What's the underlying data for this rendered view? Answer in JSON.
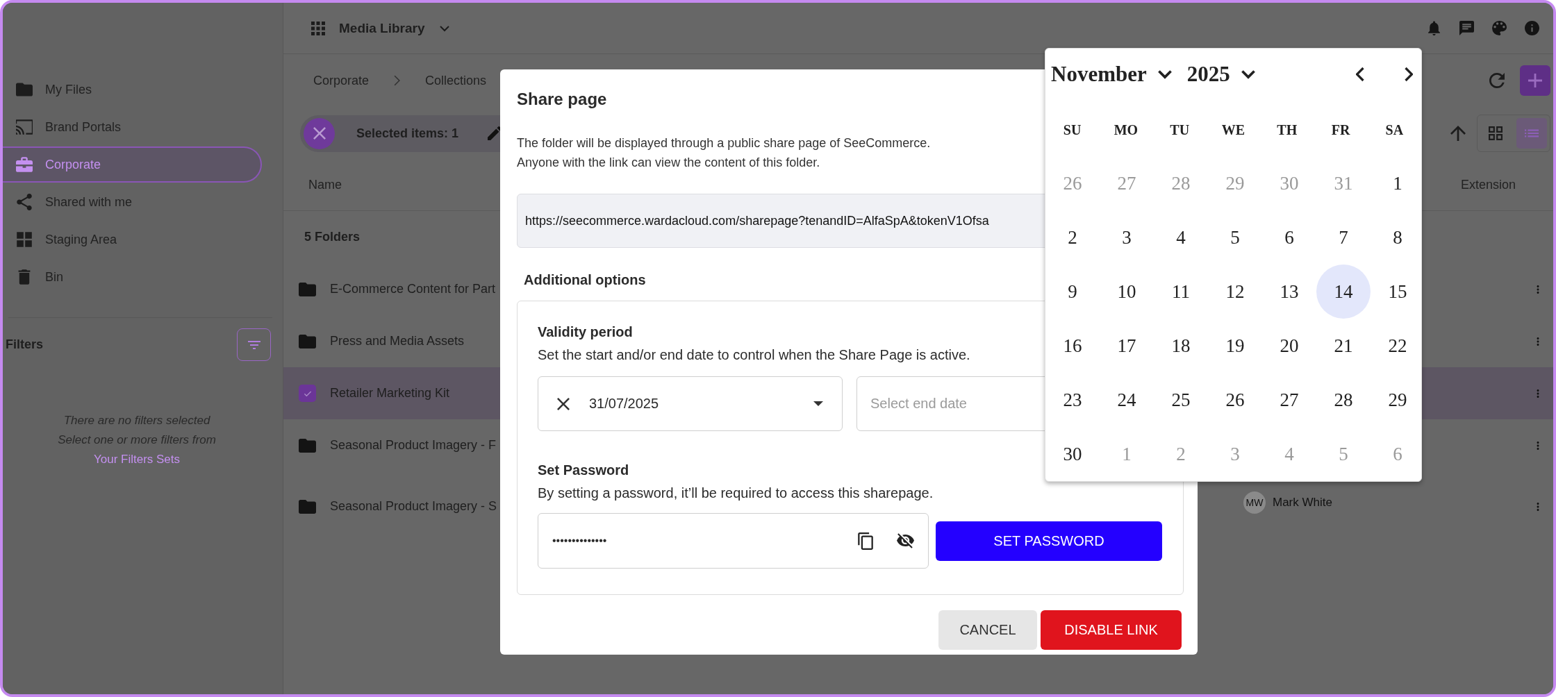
{
  "app": {
    "title": "Media Library"
  },
  "sidebar": {
    "items": [
      {
        "label": "My Files",
        "kind": "folder",
        "selected": false
      },
      {
        "label": "Brand Portals",
        "kind": "cast",
        "selected": false
      },
      {
        "label": "Corporate",
        "kind": "briefcase",
        "selected": true
      },
      {
        "label": "Shared with me",
        "kind": "share",
        "selected": false
      },
      {
        "label": "Staging Area",
        "kind": "grid",
        "selected": false
      },
      {
        "label": "Bin",
        "kind": "trash",
        "selected": false
      }
    ],
    "filters": {
      "title": "Filters",
      "empty_lines": [
        "There are no filters selected",
        "Select one or more filters from"
      ],
      "link": "Your Filters Sets"
    }
  },
  "breadcrumb": [
    "Corporate",
    "Collections"
  ],
  "selection": {
    "label": "Selected items: 1"
  },
  "view_toggle": [
    {
      "kind": "grid",
      "selected": false
    },
    {
      "kind": "list",
      "selected": true
    }
  ],
  "table": {
    "columns": [
      "Name",
      "Extension"
    ],
    "group_label": "5 Folders",
    "rows": [
      {
        "name": "E-Commerce Content for Part",
        "selected": false
      },
      {
        "name": "Press and Media Assets",
        "selected": false
      },
      {
        "name": "Retailer Marketing Kit",
        "selected": true
      },
      {
        "name": "Seasonal Product Imagery - F",
        "selected": false
      },
      {
        "name": "Seasonal Product Imagery - S",
        "selected": false,
        "owner": {
          "initials": "MW",
          "name": "Mark White"
        }
      }
    ]
  },
  "dialog": {
    "title": "Share page",
    "description": [
      "The folder will be displayed through a public share page of SeeCommerce.",
      "Anyone with the link can view the content of this folder."
    ],
    "url": "https://seecommerce.wardacloud.com/sharepage?tenandID=AlfaSpA&tokenV1Ofsa",
    "options_title": "Additional options",
    "validity": {
      "title": "Validity period",
      "hint": "Set the start and/or end date to control when the Share Page is active.",
      "start_date": "31/07/2025",
      "end_placeholder": "Select end date"
    },
    "password": {
      "title": "Set Password",
      "hint": "By setting a password, it’ll be required to access this sharepage.",
      "value": "••••••••••••••",
      "button": "SET PASSWORD"
    },
    "buttons": [
      {
        "label": "CANCEL",
        "kind": "secondary"
      },
      {
        "label": "DISABLE LINK",
        "kind": "danger"
      }
    ]
  },
  "date_picker": {
    "month": "November",
    "year": "2025",
    "weekdays": [
      "SU",
      "MO",
      "TU",
      "WE",
      "TH",
      "FR",
      "SA"
    ],
    "days": [
      {
        "label": "26",
        "outside": true,
        "selected": false
      },
      {
        "label": "27",
        "outside": true,
        "selected": false
      },
      {
        "label": "28",
        "outside": true,
        "selected": false
      },
      {
        "label": "29",
        "outside": true,
        "selected": false
      },
      {
        "label": "30",
        "outside": true,
        "selected": false
      },
      {
        "label": "31",
        "outside": true,
        "selected": false
      },
      {
        "label": "1",
        "outside": false,
        "selected": false
      },
      {
        "label": "2",
        "outside": false,
        "selected": false
      },
      {
        "label": "3",
        "outside": false,
        "selected": false
      },
      {
        "label": "4",
        "outside": false,
        "selected": false
      },
      {
        "label": "5",
        "outside": false,
        "selected": false
      },
      {
        "label": "6",
        "outside": false,
        "selected": false
      },
      {
        "label": "7",
        "outside": false,
        "selected": false
      },
      {
        "label": "8",
        "outside": false,
        "selected": false
      },
      {
        "label": "9",
        "outside": false,
        "selected": false
      },
      {
        "label": "10",
        "outside": false,
        "selected": false
      },
      {
        "label": "11",
        "outside": false,
        "selected": false
      },
      {
        "label": "12",
        "outside": false,
        "selected": false
      },
      {
        "label": "13",
        "outside": false,
        "selected": false
      },
      {
        "label": "14",
        "outside": false,
        "selected": true
      },
      {
        "label": "15",
        "outside": false,
        "selected": false
      },
      {
        "label": "16",
        "outside": false,
        "selected": false
      },
      {
        "label": "17",
        "outside": false,
        "selected": false
      },
      {
        "label": "18",
        "outside": false,
        "selected": false
      },
      {
        "label": "19",
        "outside": false,
        "selected": false
      },
      {
        "label": "20",
        "outside": false,
        "selected": false
      },
      {
        "label": "21",
        "outside": false,
        "selected": false
      },
      {
        "label": "22",
        "outside": false,
        "selected": false
      },
      {
        "label": "23",
        "outside": false,
        "selected": false
      },
      {
        "label": "24",
        "outside": false,
        "selected": false
      },
      {
        "label": "25",
        "outside": false,
        "selected": false
      },
      {
        "label": "26",
        "outside": false,
        "selected": false
      },
      {
        "label": "27",
        "outside": false,
        "selected": false
      },
      {
        "label": "28",
        "outside": false,
        "selected": false
      },
      {
        "label": "29",
        "outside": false,
        "selected": false
      },
      {
        "label": "30",
        "outside": false,
        "selected": false
      },
      {
        "label": "1",
        "outside": true,
        "selected": false
      },
      {
        "label": "2",
        "outside": true,
        "selected": false
      },
      {
        "label": "3",
        "outside": true,
        "selected": false
      },
      {
        "label": "4",
        "outside": true,
        "selected": false
      },
      {
        "label": "5",
        "outside": true,
        "selected": false
      },
      {
        "label": "6",
        "outside": true,
        "selected": false
      }
    ]
  }
}
